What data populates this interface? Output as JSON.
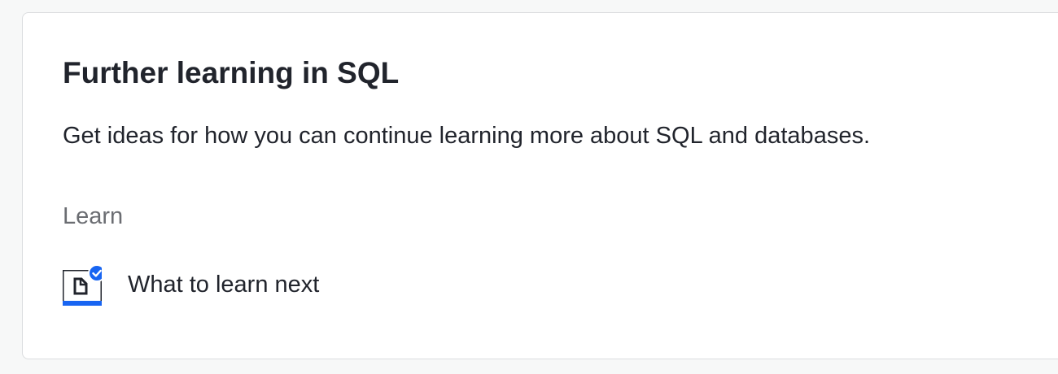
{
  "card": {
    "title": "Further learning in SQL",
    "description": "Get ideas for how you can continue learning more about SQL and databases.",
    "section_label": "Learn",
    "items": [
      {
        "label": "What to learn next",
        "icon": "article-completed-icon",
        "status": "completed"
      }
    ]
  },
  "colors": {
    "text": "#21242c",
    "muted": "#6b6d72",
    "accent": "#1865f2",
    "border": "#dbdddf",
    "background": "#f7f8f8"
  }
}
